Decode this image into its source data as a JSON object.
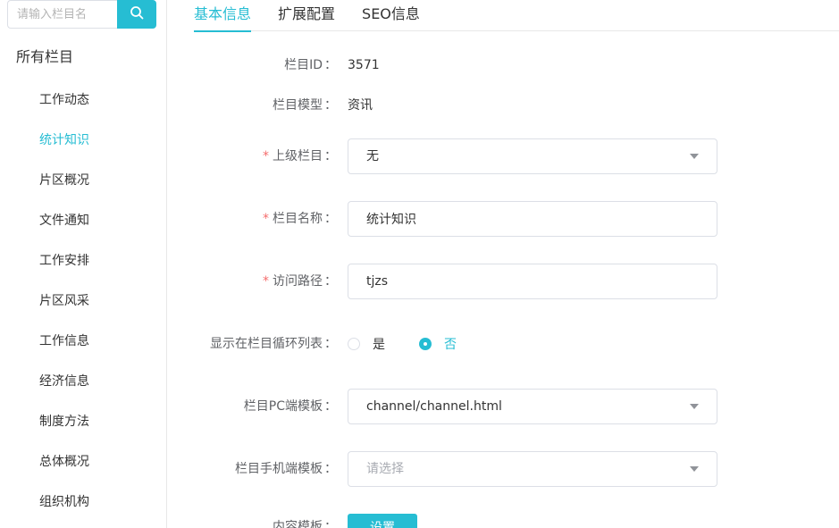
{
  "sidebar": {
    "search_placeholder": "请输入栏目名",
    "title": "所有栏目",
    "items": [
      {
        "label": "工作动态"
      },
      {
        "label": "统计知识",
        "active": true
      },
      {
        "label": "片区概况"
      },
      {
        "label": "文件通知"
      },
      {
        "label": "工作安排"
      },
      {
        "label": "片区风采"
      },
      {
        "label": "工作信息"
      },
      {
        "label": "经济信息"
      },
      {
        "label": "制度方法"
      },
      {
        "label": "总体概况"
      },
      {
        "label": "组织机构"
      }
    ]
  },
  "tabs": [
    {
      "label": "基本信息",
      "active": true
    },
    {
      "label": "扩展配置"
    },
    {
      "label": "SEO信息"
    }
  ],
  "form": {
    "colon": "：",
    "required_mark": "*",
    "channel_id": {
      "label": "栏目ID",
      "value": "3571"
    },
    "channel_model": {
      "label": "栏目模型",
      "value": "资讯"
    },
    "parent": {
      "label": "上级栏目",
      "value": "无"
    },
    "name": {
      "label": "栏目名称",
      "value": "统计知识"
    },
    "path": {
      "label": "访问路径",
      "value": "tjzs"
    },
    "show_in_loop": {
      "label": "显示在栏目循环列表",
      "yes": "是",
      "no": "否",
      "selected": "否"
    },
    "pc_template": {
      "label": "栏目PC端模板",
      "value": "channel/channel.html"
    },
    "mobile_template": {
      "label": "栏目手机端模板",
      "placeholder": "请选择"
    },
    "content_template": {
      "label": "内容模板",
      "button": "设置"
    }
  },
  "colors": {
    "accent": "#26bdd3",
    "required": "#f56c6c"
  }
}
